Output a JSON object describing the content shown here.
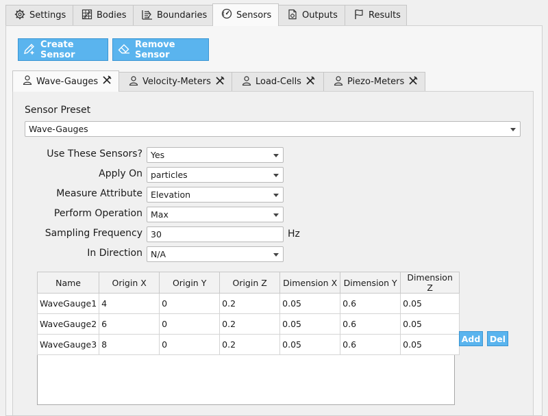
{
  "main_tabs": [
    {
      "label": "Settings",
      "icon": "gear-icon"
    },
    {
      "label": "Bodies",
      "icon": "grid-icon"
    },
    {
      "label": "Boundaries",
      "icon": "wave-icon"
    },
    {
      "label": "Sensors",
      "icon": "gauge-icon"
    },
    {
      "label": "Outputs",
      "icon": "file-icon"
    },
    {
      "label": "Results",
      "icon": "flag-icon"
    }
  ],
  "toolbar": {
    "create_label": "Create Sensor",
    "remove_label": "Remove Sensor"
  },
  "sensor_tabs": [
    {
      "label": "Wave-Gauges"
    },
    {
      "label": "Velocity-Meters"
    },
    {
      "label": "Load-Cells"
    },
    {
      "label": "Piezo-Meters"
    }
  ],
  "form": {
    "preset_label": "Sensor Preset",
    "preset_value": "Wave-Gauges",
    "use_label": "Use These Sensors?",
    "use_value": "Yes",
    "apply_label": "Apply On",
    "apply_value": "particles",
    "measure_label": "Measure Attribute",
    "measure_value": "Elevation",
    "operation_label": "Perform Operation",
    "operation_value": "Max",
    "frequency_label": "Sampling Frequency",
    "frequency_value": "30",
    "frequency_unit": "Hz",
    "direction_label": "In Direction",
    "direction_value": "N/A"
  },
  "table": {
    "headers": [
      "Name",
      "Origin X",
      "Origin Y",
      "Origin Z",
      "Dimension X",
      "Dimension Y",
      "Dimension Z"
    ],
    "rows": [
      [
        "WaveGauge1",
        "4",
        "0",
        "0.2",
        "0.05",
        "0.6",
        "0.05"
      ],
      [
        "WaveGauge2",
        "6",
        "0",
        "0.2",
        "0.05",
        "0.6",
        "0.05"
      ],
      [
        "WaveGauge3",
        "8",
        "0",
        "0.2",
        "0.05",
        "0.6",
        "0.05"
      ]
    ],
    "add_label": "Add",
    "del_label": "Del"
  },
  "colors": {
    "accent": "#5ab4ee",
    "accent_border": "#3a95d3"
  }
}
